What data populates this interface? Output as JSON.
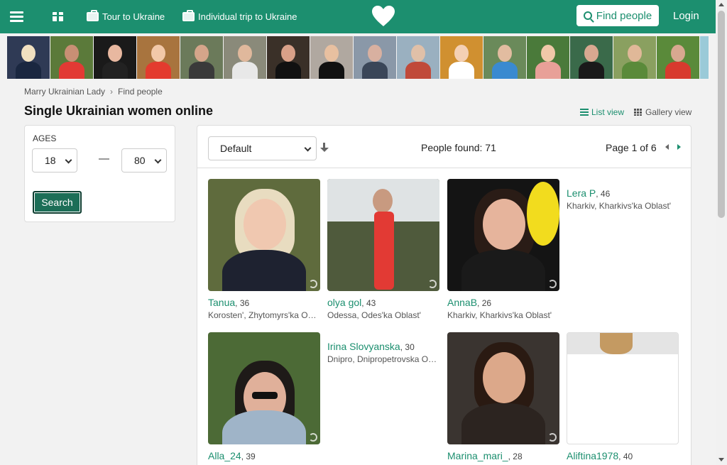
{
  "nav": {
    "menu_icon": "hamburger-icon",
    "gift_icon": "gift-icon",
    "tour_label": "Tour to Ukraine",
    "trip_label": "Individual trip to Ukraine",
    "logo_icon": "heart-icon",
    "find_people_label": "Find people",
    "login_label": "Login",
    "accent": "#1c8f6f"
  },
  "strip": {
    "count": 17
  },
  "breadcrumb": {
    "home": "Marry Ukrainian Lady",
    "current": "Find people"
  },
  "page_title": "Single Ukrainian women online",
  "views": {
    "list": "List view",
    "gallery": "Gallery view"
  },
  "filter": {
    "ages_label": "AGES",
    "age_min": "18",
    "age_max": "80",
    "dash": "—",
    "search_label": "Search"
  },
  "results": {
    "sort_value": "Default",
    "people_found": "People found: 71",
    "page_info": "Page 1 of 6"
  },
  "profiles": [
    {
      "name": "Tanua",
      "age": "36",
      "location": "Korosten', Zhytomyrs'ka Oblast'"
    },
    {
      "name": "olya gol",
      "age": "43",
      "location": "Odessa, Odes'ka Oblast'"
    },
    {
      "name": "AnnaB",
      "age": "26",
      "location": "Kharkiv, Kharkivs'ka Oblast'"
    },
    {
      "name": "Lera P",
      "age": "46",
      "location": "Kharkiv, Kharkivs'ka Oblast'"
    },
    {
      "name": "Alla_24",
      "age": "39",
      "location": ""
    },
    {
      "name": "Irina Slovyanska",
      "age": "30",
      "location": "Dnipro, Dnipropetrovska Oblast'"
    },
    {
      "name": "Marina_mari_",
      "age": "28",
      "location": ""
    },
    {
      "name": "Aliftina1978",
      "age": "40",
      "location": ""
    }
  ]
}
